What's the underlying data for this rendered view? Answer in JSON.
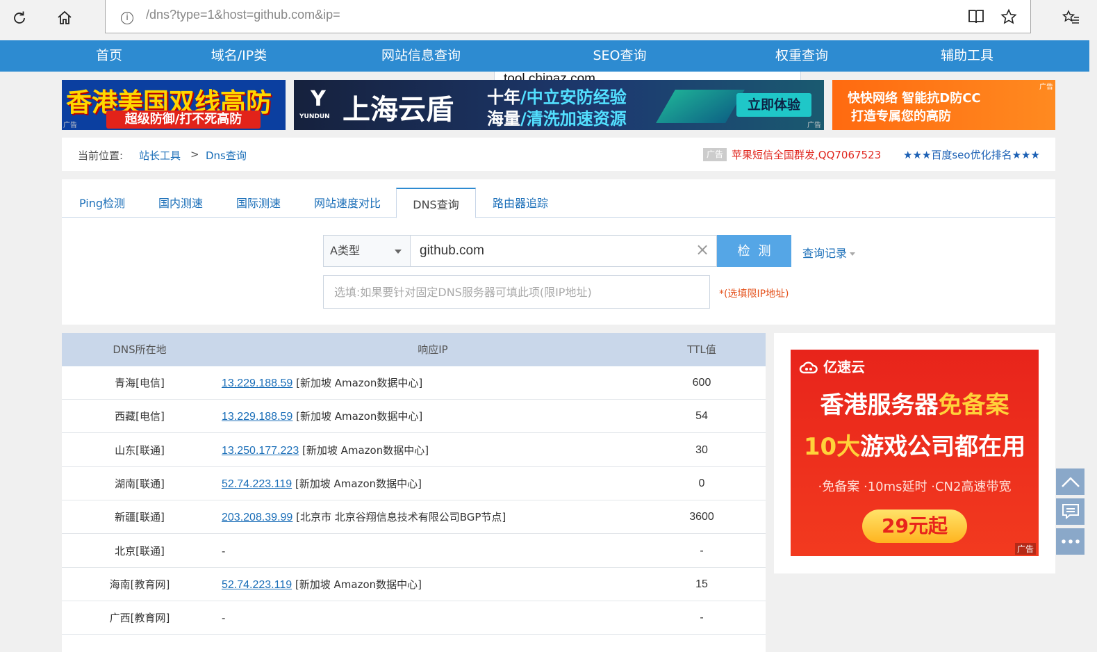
{
  "browser": {
    "url_host": "tool.chinaz.com",
    "url_path": "/dns?type=1&host=github.com&ip=",
    "icons": [
      "refresh-icon",
      "home-icon",
      "info-icon",
      "reading-view-icon",
      "favorite-star-icon",
      "favorites-list-icon"
    ]
  },
  "nav": {
    "items": [
      "首页",
      "域名/IP类",
      "网站信息查询",
      "SEO查询",
      "权重查询",
      "辅助工具"
    ]
  },
  "ads": {
    "ad1": {
      "line1": "香港美国双线高防",
      "line2": "超级防御/打不死高防",
      "tag": "广告"
    },
    "ad2": {
      "logo": "Y",
      "brand": "上海云盾",
      "sub": "YUNDUN",
      "line1_a": "十年",
      "line1_b": "/中立安防经验",
      "line2_a": "海量",
      "line2_b": "/清洗加速资源",
      "cta": "立即体验",
      "tag": "广告"
    },
    "ad3": {
      "line1": "快快网络 智能抗D防CC",
      "line2": "打造专属您的高防",
      "tag": "广告"
    }
  },
  "breadcrumb": {
    "label": "当前位置:",
    "link1": "站长工具",
    "sep": ">",
    "link2": "Dns查询",
    "ad_tag": "广告",
    "red_link": "苹果短信全国群发,QQ7067523",
    "blue_link": "★★★百度seo优化排名★★★"
  },
  "tabs": [
    "Ping检测",
    "国内测速",
    "国际测速",
    "网站速度对比",
    "DNS查询",
    "路由器追踪"
  ],
  "form": {
    "type_select": "A类型",
    "host_value": "github.com",
    "submit_label": "检测",
    "history_label": "查询记录",
    "ip_placeholder": "选填:如果要针对固定DNS服务器可填此项(限IP地址)",
    "ip_hint": "*(选填限IP地址)"
  },
  "table": {
    "headers": [
      "DNS所在地",
      "响应IP",
      "TTL值"
    ],
    "rows": [
      {
        "loc": "青海[电信]",
        "ip": "13.229.188.59",
        "where": "[新加坡 Amazon数据中心]",
        "ttl": "600"
      },
      {
        "loc": "西藏[电信]",
        "ip": "13.229.188.59",
        "where": "[新加坡 Amazon数据中心]",
        "ttl": "54"
      },
      {
        "loc": "山东[联通]",
        "ip": "13.250.177.223",
        "where": "[新加坡 Amazon数据中心]",
        "ttl": "30"
      },
      {
        "loc": "湖南[联通]",
        "ip": "52.74.223.119",
        "where": "[新加坡 Amazon数据中心]",
        "ttl": "0"
      },
      {
        "loc": "新疆[联通]",
        "ip": "203.208.39.99",
        "where": "[北京市 北京谷翔信息技术有限公司BGP节点]",
        "ttl": "3600"
      },
      {
        "loc": "北京[联通]",
        "ip": "",
        "where": "-",
        "ttl": "-"
      },
      {
        "loc": "海南[教育网]",
        "ip": "52.74.223.119",
        "where": "[新加坡 Amazon数据中心]",
        "ttl": "15"
      },
      {
        "loc": "广西[教育网]",
        "ip": "",
        "where": "-",
        "ttl": "-"
      }
    ]
  },
  "side_ad": {
    "logo": "亿速云",
    "h1_a": "香港服务器",
    "h1_b": "免备案",
    "h2_a": "10大",
    "h2_b": "游戏公司都在用",
    "features": "·免备案 ·10ms延时 ·CN2高速带宽",
    "price": "29元起",
    "tag": "广告"
  },
  "float_buttons": [
    "back-to-top-icon",
    "feedback-icon",
    "more-icon"
  ],
  "colors": {
    "nav_bg": "#2d8bd1",
    "link": "#1a6eb8",
    "table_header": "#c9d7ea",
    "submit_bg": "#55a6e6"
  }
}
